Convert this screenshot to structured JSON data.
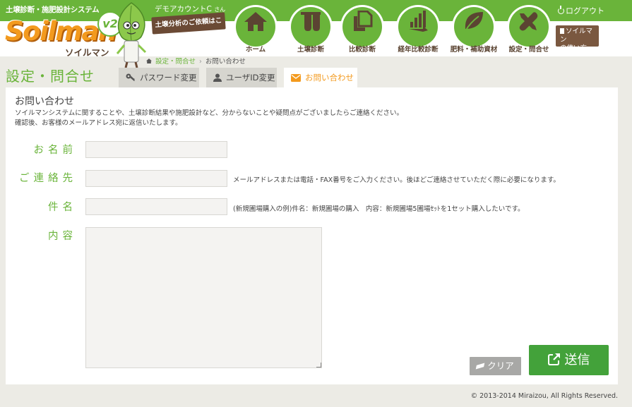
{
  "header": {
    "system_title": "土壌診断・施肥設計システム",
    "user_name": "デモアカウントC",
    "user_suffix": "さん",
    "logout_label": "ログアウト",
    "soil_banner": "土壌分析のご依頼はこちら",
    "guide_label_1": "ソイルマン",
    "guide_label_2": "の使い方"
  },
  "logo": {
    "brand": "Soilman",
    "brand_kana": "ソイルマン",
    "version": "v2"
  },
  "nav": [
    {
      "label": "ホーム",
      "icon": "home-icon"
    },
    {
      "label": "土壌診断",
      "icon": "flask-icon"
    },
    {
      "label": "比較診断",
      "icon": "copy-icon"
    },
    {
      "label": "経年比較診断",
      "icon": "chart-arrow-icon"
    },
    {
      "label": "肥料・補助資材",
      "icon": "leaf-icon"
    },
    {
      "label": "設定・問合せ",
      "icon": "tools-icon"
    }
  ],
  "breadcrumb": {
    "parent": "設定・問合せ",
    "current": "お問い合わせ"
  },
  "page_title": "設定・問合せ",
  "tabs": [
    {
      "label": "パスワード変更",
      "icon": "key-icon"
    },
    {
      "label": "ユーザID変更",
      "icon": "user-icon"
    },
    {
      "label": "お問い合わせ",
      "icon": "envelope-icon"
    }
  ],
  "form": {
    "title": "お問い合わせ",
    "desc_line1": "ソイルマンシステムに関することや、土壌診断結果や施肥設計など、分からないことや疑問点がございましたらご連絡ください。",
    "desc_line2": "確認後、お客様のメールアドレス宛に返信いたします。",
    "name_label": "お名前",
    "name_value": "",
    "contact_label": "ご連絡先",
    "contact_value": "",
    "contact_hint": "メールアドレスまたは電話・FAX番号をご入力ください。後ほどご連絡させていただく際に必要になります。",
    "subject_label": "件名",
    "subject_value": "",
    "subject_hint": "(新規圃場購入の例)件名：新規圃場の購入　内容：新規圃場5圃場ｾｯﾄを1セット購入したいです。",
    "content_label": "内容",
    "content_value": "",
    "clear_label": "クリア",
    "send_label": "送信"
  },
  "footer": {
    "copyright": "© 2013-2014 Miraizou, All Rights Reserved."
  },
  "colors": {
    "brand_green": "#6ab43a",
    "send_green": "#43a23a",
    "accent_orange": "#f39a1e",
    "brown": "#6b4a35"
  }
}
